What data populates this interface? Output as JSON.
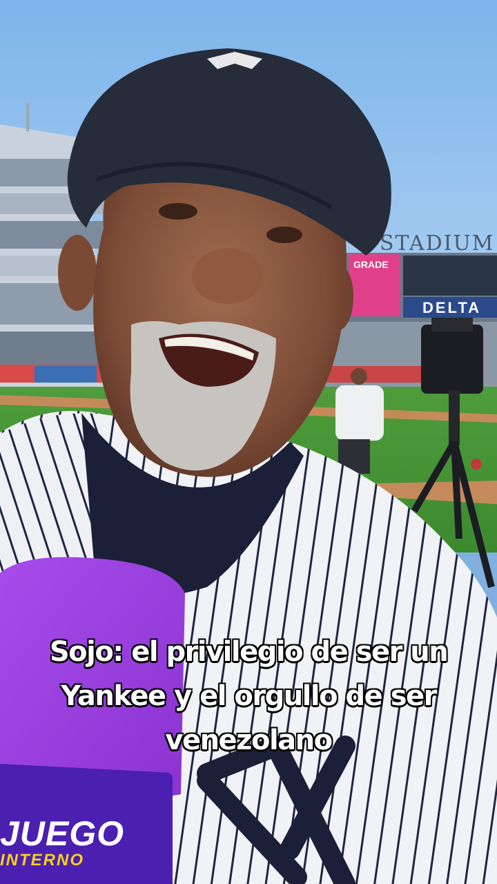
{
  "caption": {
    "line1": "Sojo: el privilegio de ser un",
    "line2": "Yankee y el orgullo de ser",
    "line3": "venezolano"
  },
  "background": {
    "stadium_sign": "STADIUM",
    "sponsor_board": "DELTA",
    "pink_board": "GRADE"
  },
  "mic_flag": {
    "brand": "JUEGO",
    "sub": "INTERNO"
  },
  "colors": {
    "sky": "#8ec0ef",
    "jersey": "#f2f3f6",
    "pinstripe": "#1d2540",
    "cap": "#262c3a",
    "mic_foam": "#9b3fe0",
    "mic_flag": "#4b1fb0",
    "mic_sub_text": "#f3d21a"
  }
}
